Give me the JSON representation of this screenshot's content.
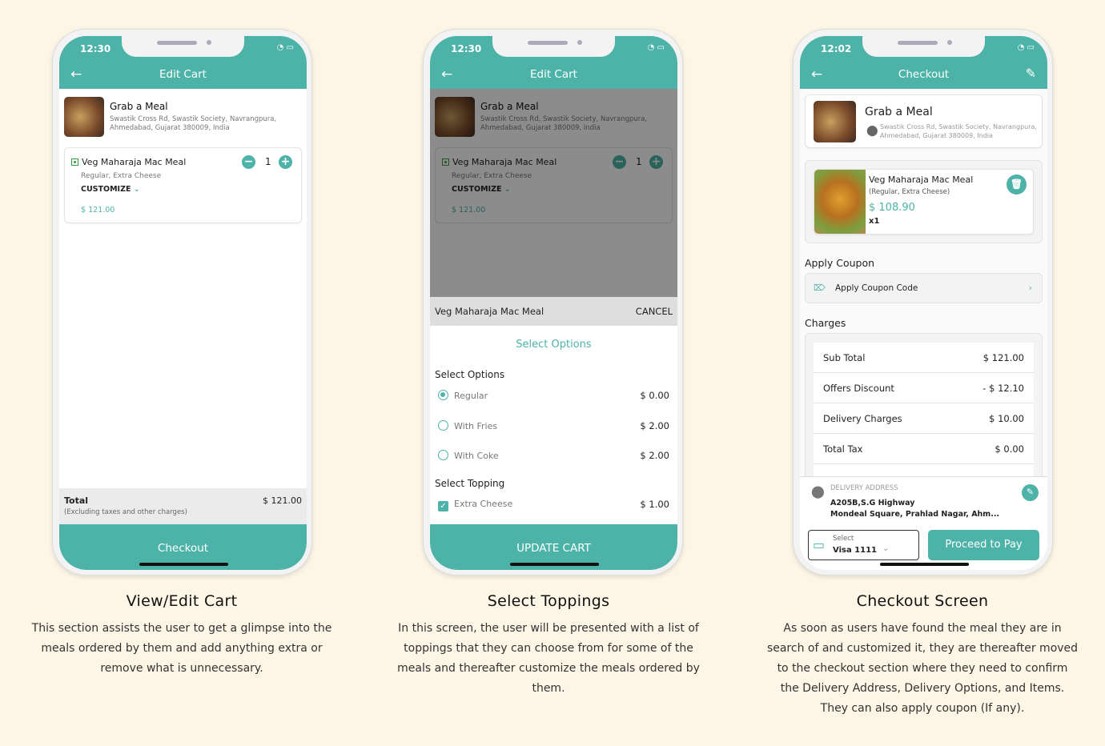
{
  "colors": {
    "accent": "#4db3a8",
    "background": "#fdf6e6"
  },
  "restaurant": {
    "name": "Grab a Meal",
    "address": "Swastik Cross Rd, Swastik Society, Navrangpura, Ahmedabad, Gujarat 380009, India"
  },
  "phone1": {
    "time": "12:30",
    "title": "Edit Cart",
    "item": {
      "name": "Veg Maharaja Mac Meal",
      "options": "Regular, Extra Cheese",
      "customize": "CUSTOMIZE",
      "qty": "1",
      "price": "$ 121.00"
    },
    "total_label": "Total",
    "total_note": "(Excluding taxes and other charges)",
    "total_value": "$ 121.00",
    "checkout": "Checkout"
  },
  "phone2": {
    "time": "12:30",
    "title": "Edit Cart",
    "item": {
      "name": "Veg Maharaja Mac Meal",
      "options": "Regular, Extra Cheese",
      "customize": "CUSTOMIZE",
      "qty": "1",
      "price": "$ 121.00"
    },
    "sheet": {
      "item": "Veg Maharaja Mac Meal",
      "cancel": "CANCEL",
      "heading": "Select Options",
      "options_label": "Select Options",
      "options": [
        {
          "label": "Regular",
          "price": "$ 0.00",
          "selected": true
        },
        {
          "label": "With Fries",
          "price": "$ 2.00",
          "selected": false
        },
        {
          "label": "With Coke",
          "price": "$ 2.00",
          "selected": false
        }
      ],
      "topping_label": "Select Topping",
      "toppings": [
        {
          "label": "Extra Cheese",
          "price": "$ 1.00",
          "checked": true
        }
      ]
    },
    "update": "UPDATE CART"
  },
  "phone3": {
    "time": "12:02",
    "title": "Checkout",
    "item": {
      "name": "Veg Maharaja Mac Meal",
      "options": "(Regular, Extra Cheese)",
      "price": "$ 108.90",
      "qty": "x1"
    },
    "coupon_heading": "Apply Coupon",
    "coupon_label": "Apply Coupon Code",
    "charges_heading": "Charges",
    "charges": [
      {
        "label": "Sub Total",
        "value": "$ 121.00"
      },
      {
        "label": "Offers Discount",
        "value": "- $ 12.10"
      },
      {
        "label": "Delivery Charges",
        "value": "$ 10.00"
      },
      {
        "label": "Total Tax",
        "value": "$ 0.00"
      }
    ],
    "delivery_label": "DELIVERY ADDRESS",
    "address1": "A205B,S.G Highway",
    "address2": "Mondeal Square, Prahlad Nagar, Ahm...",
    "pay_select": "Select",
    "pay_card": "Visa 1111",
    "proceed": "Proceed to Pay"
  },
  "captions": [
    {
      "title": "View/Edit Cart",
      "text": "This section assists the user to get a glimpse into the meals ordered by them and add anything extra or remove what is unnecessary."
    },
    {
      "title": "Select Toppings",
      "text": "In this screen, the user will be presented with a list of toppings that they can choose from for some of the meals and thereafter customize the meals ordered by them."
    },
    {
      "title": "Checkout Screen",
      "text": "As soon as users have found the meal they are in search of and customized it, they are thereafter moved to the checkout section where they need to confirm the Delivery Address, Delivery Options, and Items. They can also apply coupon (If any)."
    }
  ]
}
